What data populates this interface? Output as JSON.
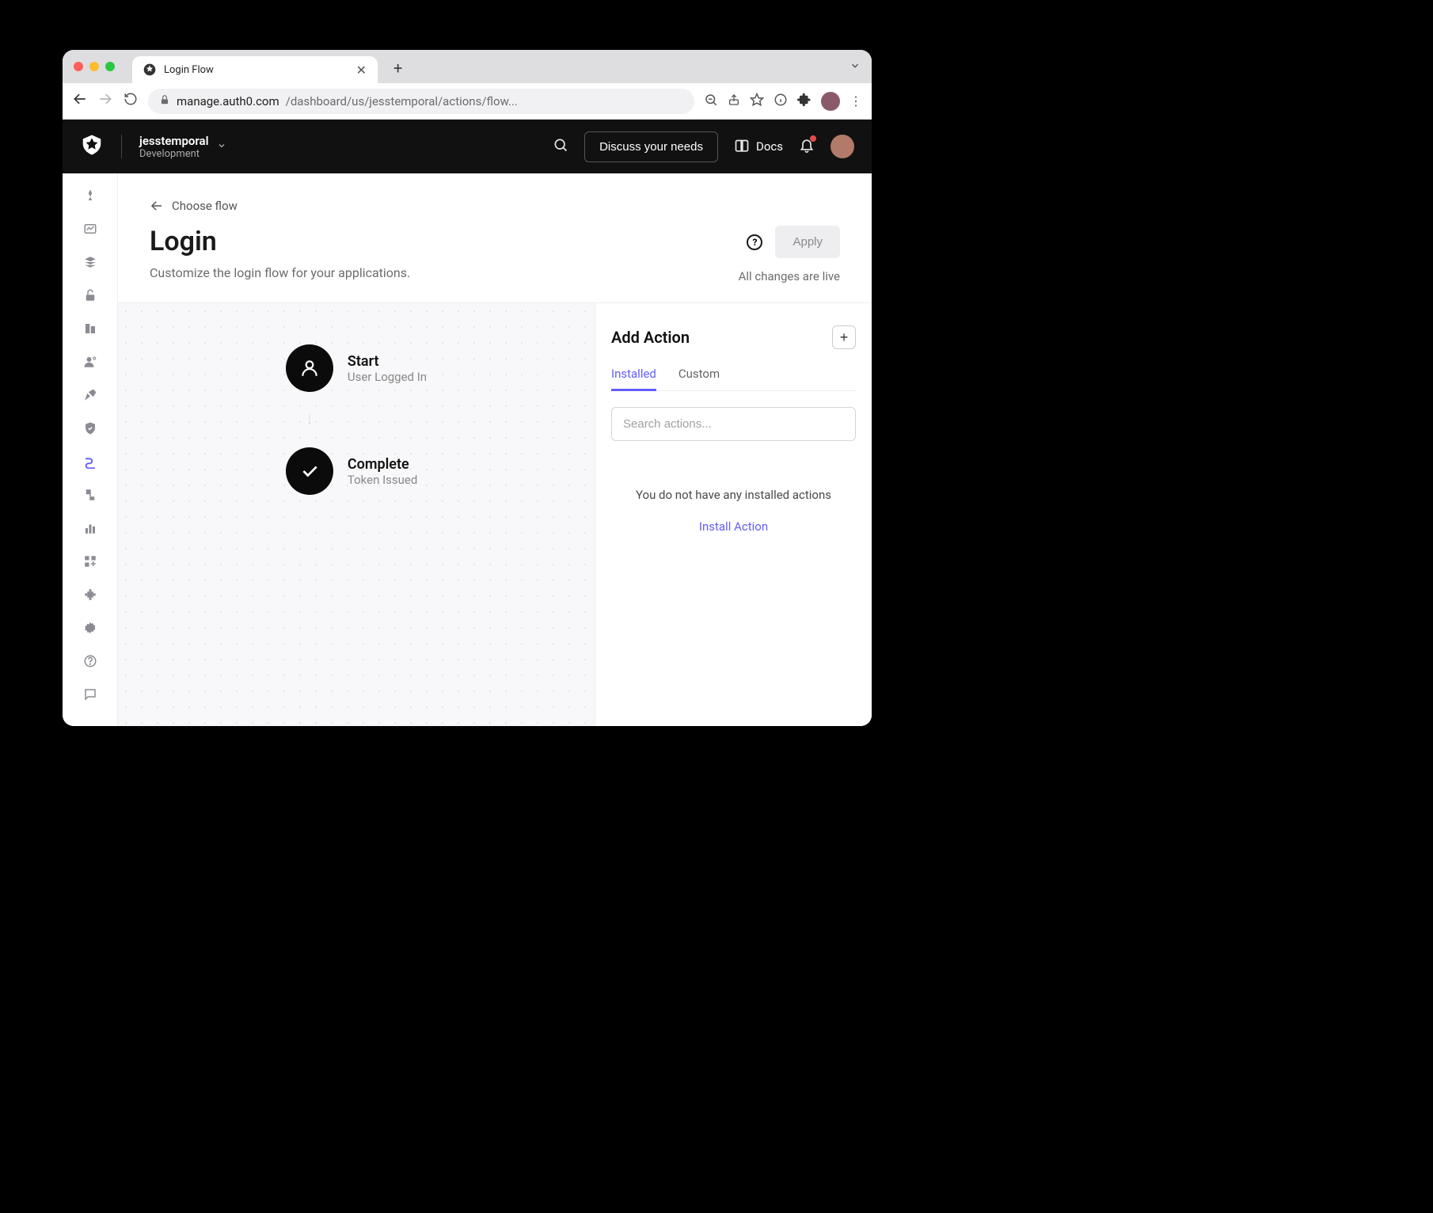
{
  "browser": {
    "tab_title": "Login Flow",
    "url_domain": "manage.auth0.com",
    "url_path": "/dashboard/us/jesstemporal/actions/flow..."
  },
  "header": {
    "tenant_name": "jesstemporal",
    "tenant_env": "Development",
    "discuss_label": "Discuss your needs",
    "docs_label": "Docs"
  },
  "breadcrumb": {
    "label": "Choose flow"
  },
  "page": {
    "title": "Login",
    "subtitle": "Customize the login flow for your applications.",
    "apply_label": "Apply",
    "live_text": "All changes are live"
  },
  "flow": {
    "start_title": "Start",
    "start_sub": "User Logged In",
    "complete_title": "Complete",
    "complete_sub": "Token Issued"
  },
  "panel": {
    "title": "Add Action",
    "tabs": {
      "installed": "Installed",
      "custom": "Custom"
    },
    "search_placeholder": "Search actions...",
    "empty_text": "You do not have any installed actions",
    "install_link": "Install Action"
  }
}
